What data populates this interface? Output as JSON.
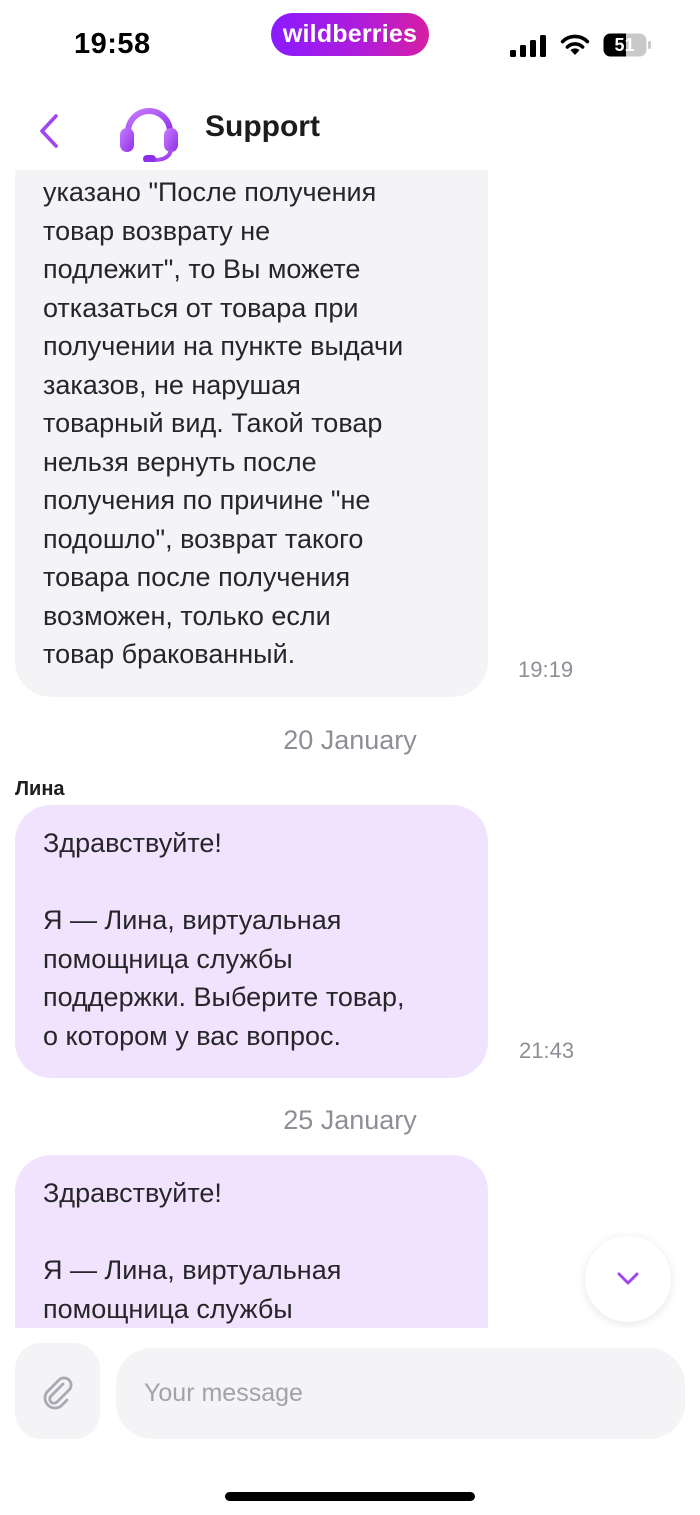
{
  "status_bar": {
    "time": "19:58",
    "brand": "wildberries",
    "battery_level": "51",
    "brand_gradient": [
      "#8a1bff",
      "#d61fa2"
    ],
    "icons": [
      "signal-icon",
      "wifi-icon",
      "battery-icon"
    ]
  },
  "header": {
    "title": "Support",
    "back_icon": "chevron-left-icon",
    "avatar_icon": "headset-icon",
    "accent_color": "#a146f5"
  },
  "messages": [
    {
      "type": "incoming",
      "text": "указано \"После получения\nтовар возврату не\nподлежит\", то Вы можете\nотказаться от товара при\nполучении на пункте выдачи\nзаказов, не нарушая\nтоварный вид. Такой товар\nнельзя вернуть после\nполучения по причине \"не\nподошло\", возврат такого\nтовара после получения\nвозможен, только если\nтовар бракованный.",
      "time": "19:19"
    },
    {
      "type": "date",
      "text": "20 January"
    },
    {
      "type": "sender",
      "text": "Лина"
    },
    {
      "type": "bot",
      "text": "Здравствуйте!\n\nЯ — Лина, виртуальная\nпомощница службы\nподдержки. Выберите товар,\nо котором у вас вопрос.",
      "time": "21:43"
    },
    {
      "type": "date",
      "text": "25 January"
    },
    {
      "type": "bot",
      "text": "Здравствуйте!\n\nЯ — Лина, виртуальная\nпомощница службы"
    }
  ],
  "colors": {
    "incoming_bubble": "#f4f4f6",
    "bot_bubble": "#f1e3fd",
    "accent": "#a146f5"
  },
  "composer": {
    "placeholder": "Your message",
    "attach_icon": "paperclip-icon",
    "scroll_icon": "chevron-down-icon"
  }
}
